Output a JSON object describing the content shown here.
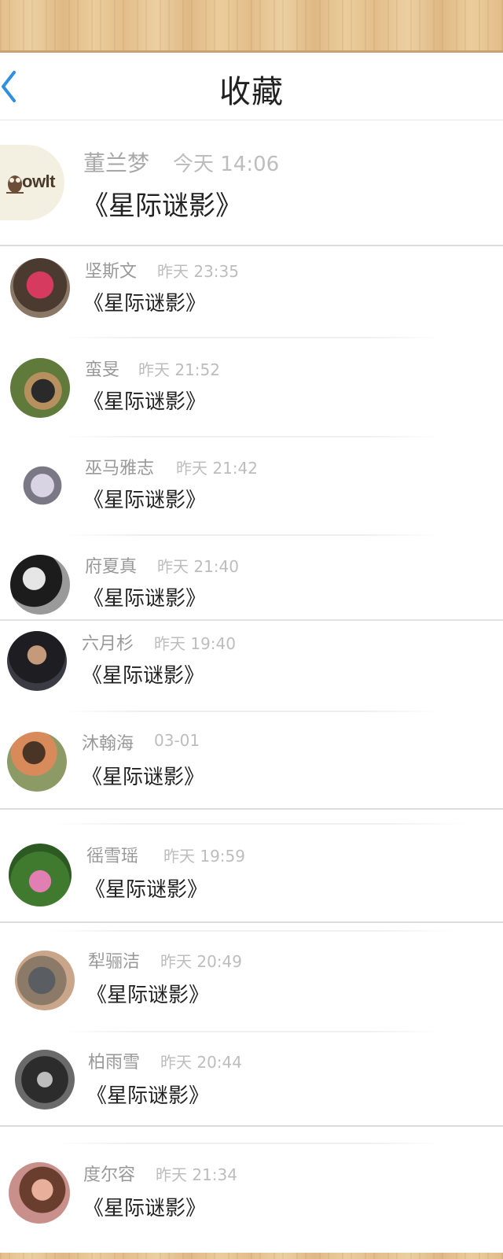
{
  "header": {
    "title": "收藏",
    "back_icon": "chevron-left-icon"
  },
  "items": [
    {
      "name": "董兰梦",
      "time": "今天 14:06",
      "title": "《星际谜影》",
      "avatar": "owlt-logo"
    },
    {
      "name": "坚斯文",
      "time": "昨天 23:35",
      "title": "《星际谜影》",
      "avatar": "person-red-jacket"
    },
    {
      "name": "蛮旻",
      "time": "昨天 21:52",
      "title": "《星际谜影》",
      "avatar": "person-cap-grass"
    },
    {
      "name": "巫马雅志",
      "time": "昨天 21:42",
      "title": "《星际谜影》",
      "avatar": "anime-girl"
    },
    {
      "name": "府夏真",
      "time": "昨天 21:40",
      "title": "《星际谜影》",
      "avatar": "woman-bw"
    },
    {
      "name": "六月杉",
      "time": "昨天 19:40",
      "title": "《星际谜影》",
      "avatar": "man-dark"
    },
    {
      "name": "沐翰海",
      "time": "03-01",
      "title": "《星际谜影》",
      "avatar": "woman-flowers"
    },
    {
      "name": "徭雪瑶",
      "time": "昨天 19:59",
      "title": "《星际谜影》",
      "avatar": "lotus-flower"
    },
    {
      "name": "犁骊洁",
      "time": "昨天 20:49",
      "title": "《星际谜影》",
      "avatar": "birds"
    },
    {
      "name": "柏雨雪",
      "time": "昨天 20:44",
      "title": "《星际谜影》",
      "avatar": "crowd-bw"
    },
    {
      "name": "度尔容",
      "time": "昨天 21:34",
      "title": "《星际谜影》",
      "avatar": "girl-illustration"
    }
  ],
  "logo_text": "owlt"
}
